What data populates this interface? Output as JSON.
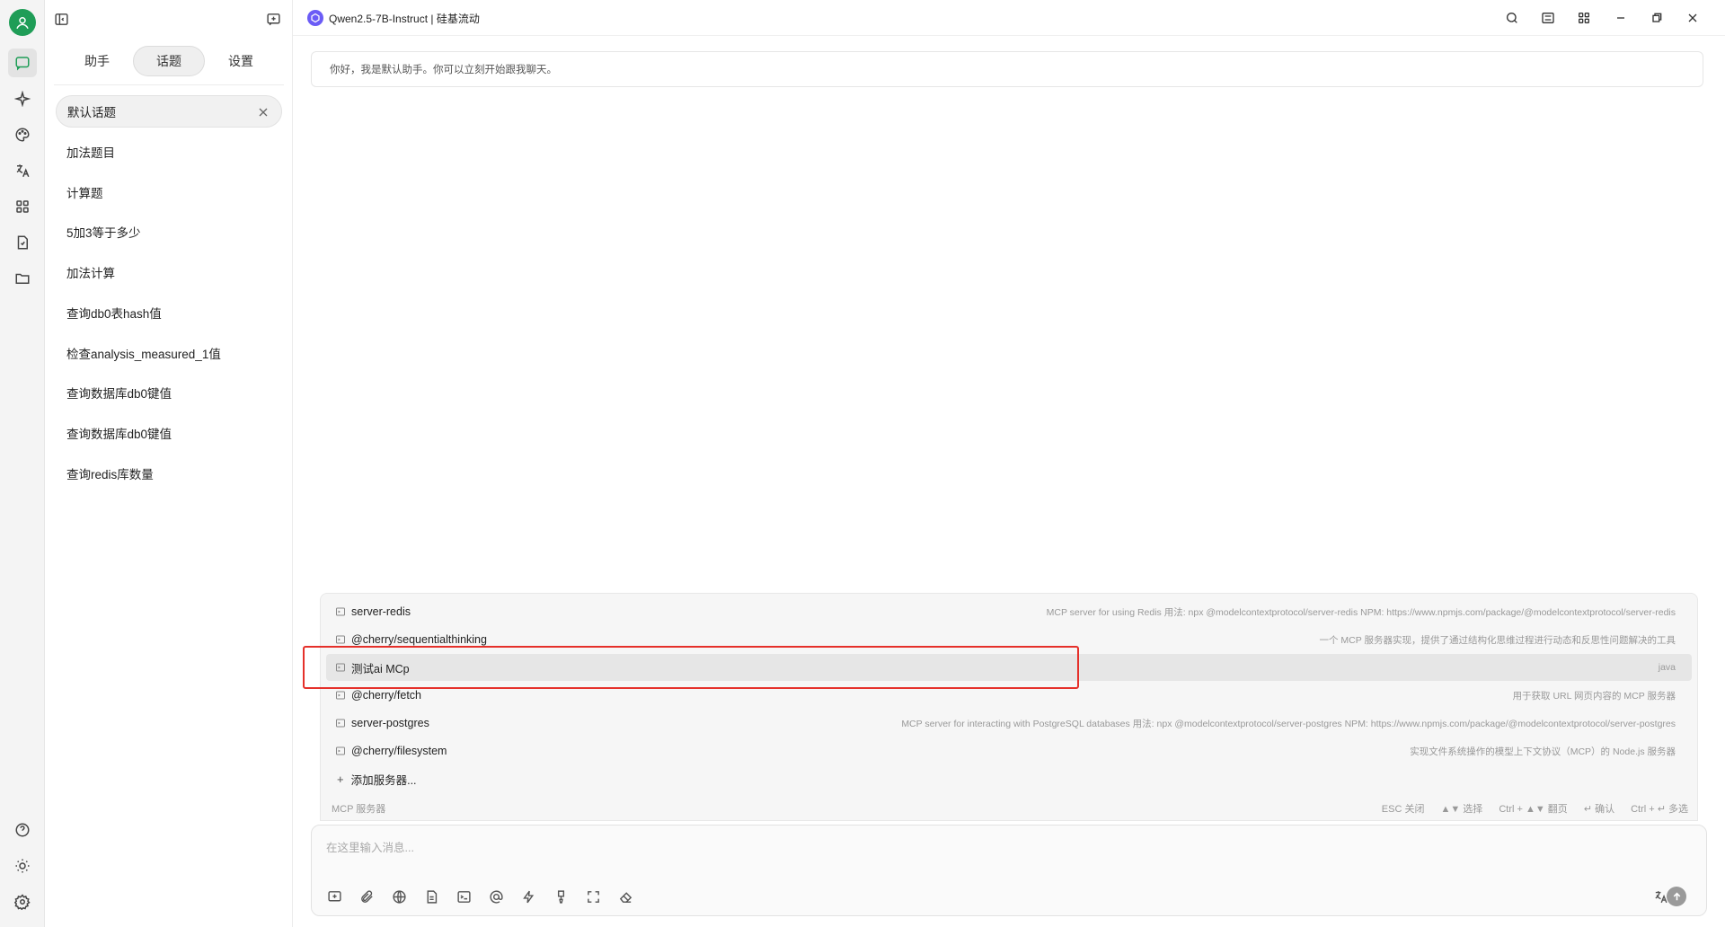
{
  "window": {
    "model_title": "Qwen2.5-7B-Instruct | 硅基流动"
  },
  "sidebar": {
    "tabs": [
      {
        "label": "助手"
      },
      {
        "label": "话题"
      },
      {
        "label": "设置"
      }
    ],
    "active_tab": 1,
    "topics": [
      {
        "label": "默认话题"
      },
      {
        "label": "加法题目"
      },
      {
        "label": "计算题"
      },
      {
        "label": "5加3等于多少"
      },
      {
        "label": "加法计算"
      },
      {
        "label": "查询db0表hash值"
      },
      {
        "label": "检查analysis_measured_1值"
      },
      {
        "label": "查询数据库db0键值"
      },
      {
        "label": "查询数据库db0键值"
      },
      {
        "label": "查询redis库数量"
      }
    ]
  },
  "chat": {
    "greeting": "你好，我是默认助手。你可以立刻开始跟我聊天。"
  },
  "mcp": {
    "servers": [
      {
        "name": "server-redis",
        "desc": "MCP server for using Redis 用法: npx @modelcontextprotocol/server-redis NPM: https://www.npmjs.com/package/@modelcontextprotocol/server-redis"
      },
      {
        "name": "@cherry/sequentialthinking",
        "desc": "一个 MCP 服务器实现，提供了通过结构化思维过程进行动态和反思性问题解决的工具"
      },
      {
        "name": "测试ai MCp",
        "desc": "java"
      },
      {
        "name": "@cherry/fetch",
        "desc": "用于获取 URL 网页内容的 MCP 服务器"
      },
      {
        "name": "server-postgres",
        "desc": "MCP server for interacting with PostgreSQL databases 用法: npx @modelcontextprotocol/server-postgres NPM: https://www.npmjs.com/package/@modelcontextprotocol/server-postgres"
      },
      {
        "name": "@cherry/filesystem",
        "desc": "实现文件系统操作的模型上下文协议（MCP）的 Node.js 服务器"
      }
    ],
    "selected_index": 2,
    "add_label": "添加服务器...",
    "footer_label": "MCP 服务器",
    "hints": [
      "ESC 关闭",
      "▲▼ 选择",
      "Ctrl + ▲▼ 翻页",
      "↵ 确认",
      "Ctrl + ↵ 多选"
    ]
  },
  "input": {
    "placeholder": "在这里输入消息..."
  },
  "colors": {
    "brand": "#1f9d57",
    "highlight": "#e5302a",
    "model_logo": "#6b5cf6"
  },
  "icons": {
    "rail": [
      "chat-icon",
      "sparkle-icon",
      "palette-icon",
      "translate-icon",
      "apps-icon",
      "file-icon",
      "folder-icon",
      "help-icon",
      "sun-icon",
      "gear-icon"
    ],
    "toolbar": [
      "new-topic-icon",
      "attach-icon",
      "globe-icon",
      "document-icon",
      "terminal-icon",
      "mention-icon",
      "lightning-icon",
      "brush-icon",
      "expand-icon",
      "eraser-icon",
      "translate-icon",
      "send-icon"
    ]
  }
}
